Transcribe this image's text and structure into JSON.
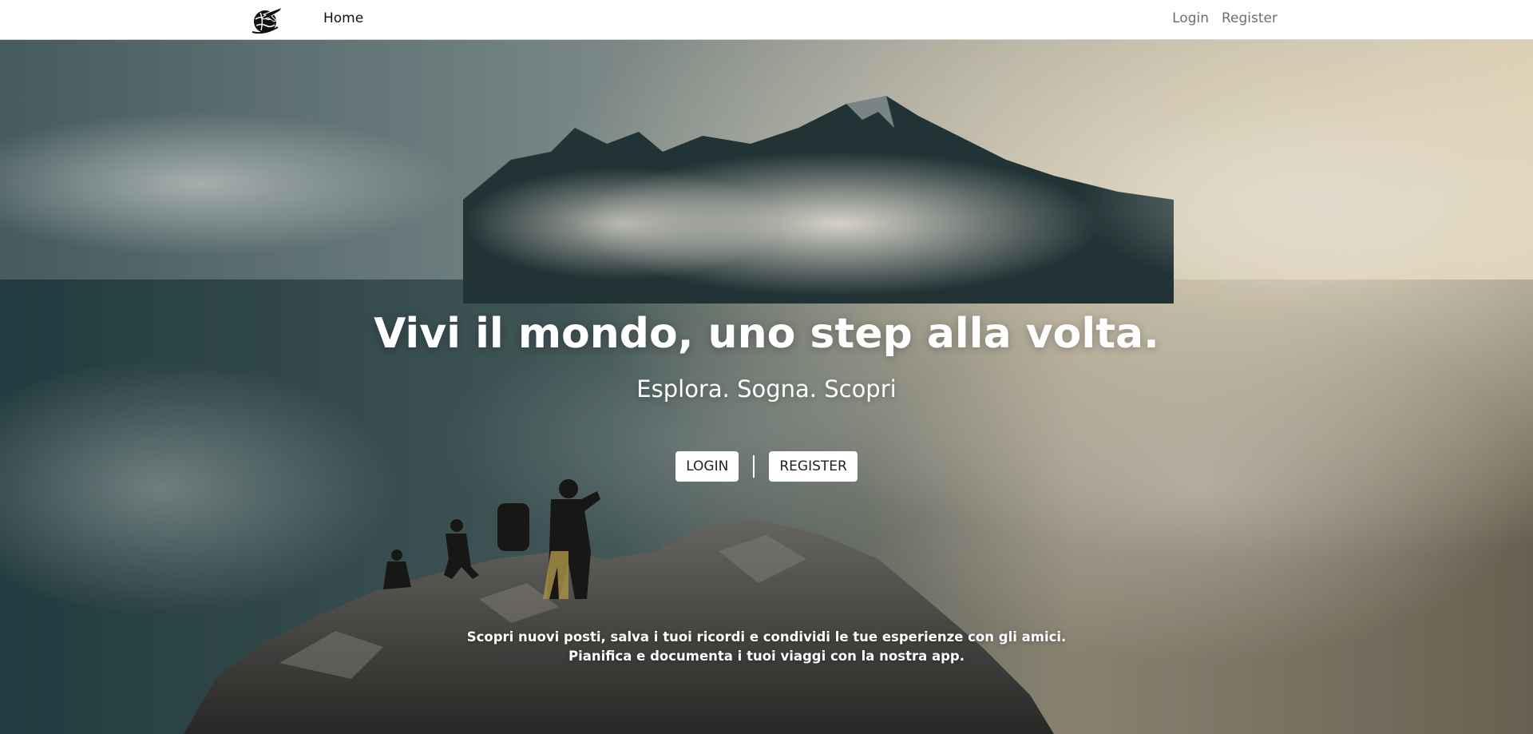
{
  "nav": {
    "logo_icon": "airplane-globe-logo",
    "home_label": "Home",
    "login_label": "Login",
    "register_label": "Register"
  },
  "hero": {
    "background_image": "mountain-summit-hikers-clouds-photo",
    "title": "Vivi il mondo, uno step alla volta.",
    "subtitle": "Esplora. Sogna. Scopri",
    "login_button": "LOGIN",
    "register_button": "REGISTER",
    "description_line1": "Scopri nuovi posti, salva i tuoi ricordi e condividi le tue esperienze con gli amici.",
    "description_line2": "Pianifica e documenta i tuoi viaggi con la nostra app."
  },
  "colors": {
    "navbar_bg": "#ffffff",
    "nav_link": "#6d6d6d",
    "hero_text": "#ffffff",
    "button_bg": "#ffffff"
  }
}
